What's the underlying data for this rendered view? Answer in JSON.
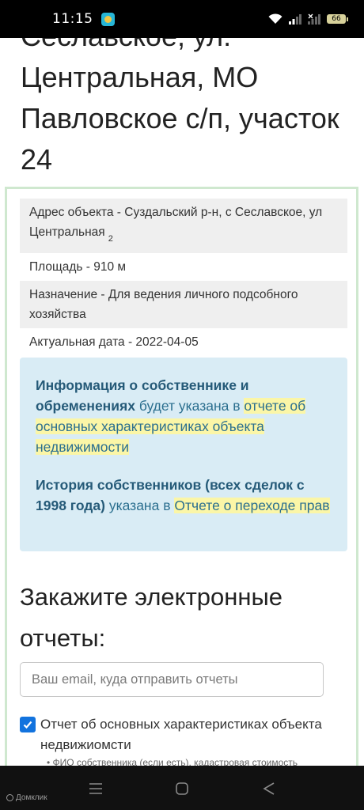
{
  "status_bar": {
    "time": "11:15",
    "battery": "66"
  },
  "page": {
    "title_lines": [
      "Сеславское, ул.",
      "Центральная, МО",
      "Павловское с/п, участок",
      "24"
    ],
    "properties": [
      {
        "text": "Адрес объекта - Суздальский р-н, с Сеславское, ул Центральная",
        "sup": "2"
      },
      {
        "text": "Площадь - 910 м",
        "sup": ""
      },
      {
        "text": "Назначение - Для ведения личного подсобного хозяйства",
        "sup": ""
      },
      {
        "text": "Актуальная дата - 2022-04-05",
        "sup": ""
      }
    ],
    "info": {
      "p1_bold": "Информация о собственнике и обременениях",
      "p1_mid": " будет указана в ",
      "p1_link": "отчете об основных характеристиках объекта недвижимости",
      "p2_bold": "История собственников (всех сделок с 1998 года)",
      "p2_mid": " указана в ",
      "p2_link": "Отчете о переходе прав"
    },
    "order_title": "Закажите электронные отчеты:",
    "email_placeholder": "Ваш email, куда отправить отчеты",
    "checkbox_label": "Отчет об основных характеристиках объекта недвижиомсти",
    "bullet_text": "• ФИО собственника (если есть), кадастровая стоимость"
  },
  "nav": {
    "watermark": "Домклик"
  },
  "icons": [
    "wifi-icon",
    "signal-icon",
    "battery-icon",
    "app-icon",
    "menu-icon",
    "home-icon",
    "back-icon",
    "check-icon"
  ]
}
